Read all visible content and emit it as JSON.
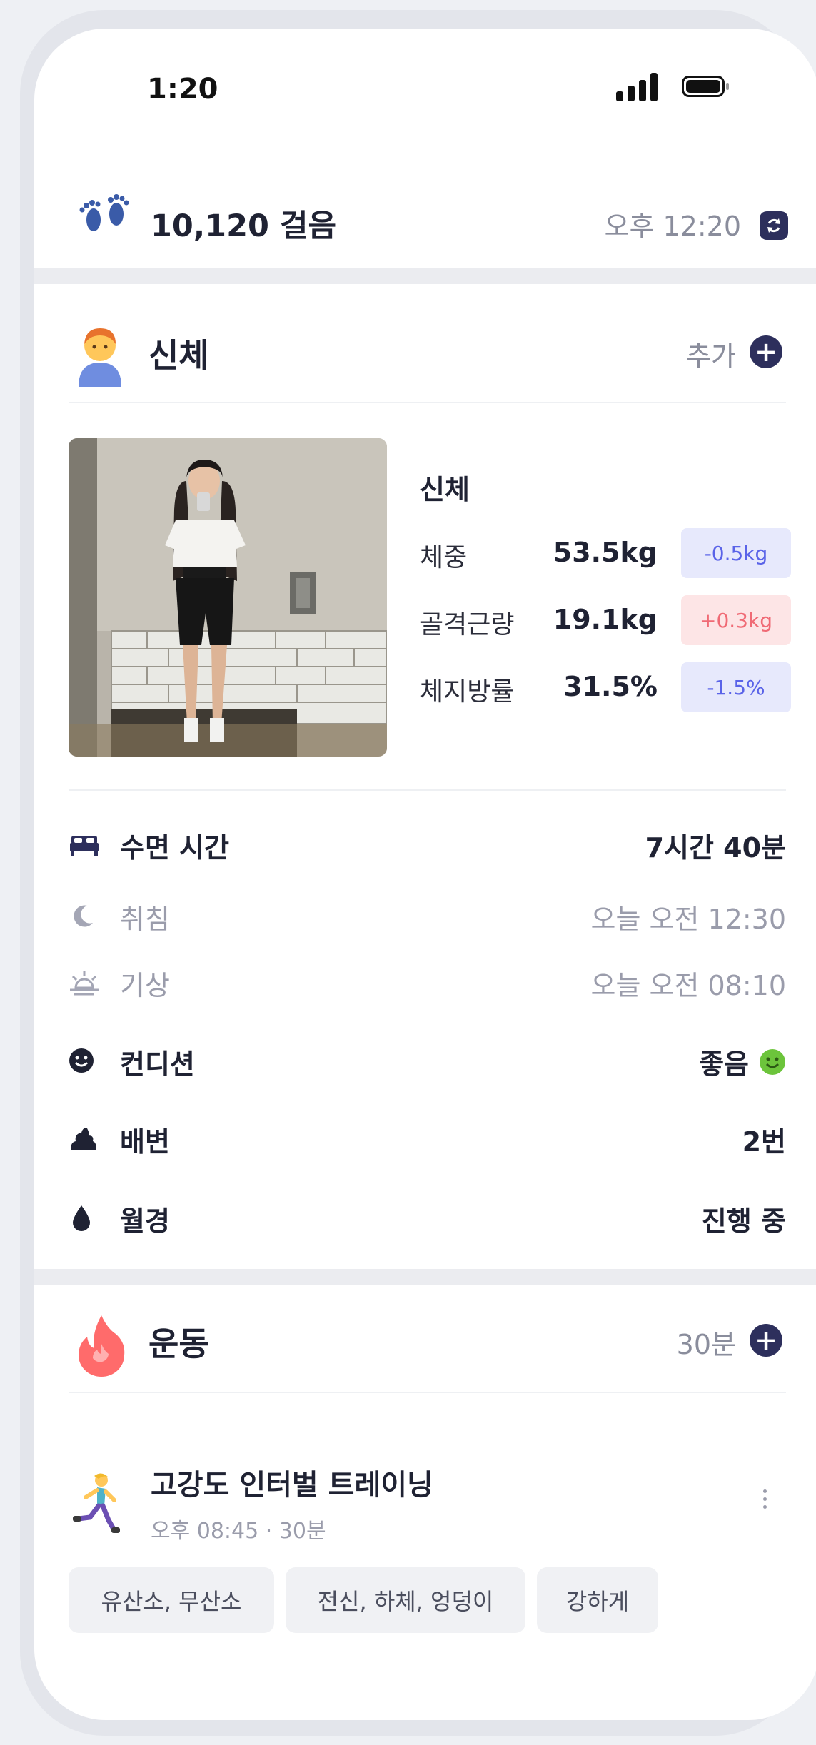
{
  "status_bar": {
    "time": "1:20"
  },
  "steps": {
    "count_label": "10,120 걸음",
    "updated_time": "오후 12:20"
  },
  "body_card": {
    "title": "신체",
    "add_label": "추가",
    "stats_title": "신체",
    "stats": [
      {
        "label": "체중",
        "value": "53.5kg",
        "change": "-0.5kg",
        "direction": "down"
      },
      {
        "label": "골격근량",
        "value": "19.1kg",
        "change": "+0.3kg",
        "direction": "up"
      },
      {
        "label": "체지방률",
        "value": "31.5%",
        "change": "-1.5%",
        "direction": "down"
      }
    ],
    "sleep": {
      "label": "수면 시간",
      "value": "7시간 40분",
      "bedtime_label": "취침",
      "bedtime_value": "오늘 오전 12:30",
      "wake_label": "기상",
      "wake_value": "오늘 오전 08:10"
    },
    "condition": {
      "label": "컨디션",
      "value": "좋음"
    },
    "bowel": {
      "label": "배변",
      "value": "2번"
    },
    "period": {
      "label": "월경",
      "value": "진행 중"
    }
  },
  "exercise_card": {
    "title": "운동",
    "total": "30분",
    "item": {
      "name": "고강도 인터벌 트레이닝",
      "meta": "오후 08:45 · 30분",
      "tags": [
        "유산소, 무산소",
        "전신, 하체, 엉덩이",
        "강하게"
      ]
    }
  },
  "colors": {
    "accent": "#2d2f5c",
    "badge_down_bg": "#e7e9fc",
    "badge_down_text": "#5a63e8",
    "badge_up_bg": "#fde5e6",
    "badge_up_text": "#f06a75",
    "condition_good": "#6cc43b"
  }
}
